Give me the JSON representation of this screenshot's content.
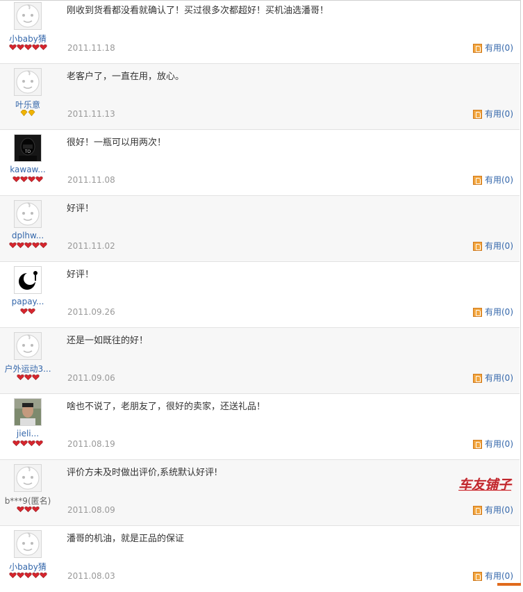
{
  "reviews": [
    {
      "user": "小baby猜",
      "rank_icon": "red-heart",
      "rank_count": 5,
      "avatar": "default-face",
      "content": "刚收到货看都没看就确认了！买过很多次都超好！买机油选潘哥！",
      "date": "2011.11.18",
      "useful": "有用(0)"
    },
    {
      "user": "叶乐意",
      "rank_icon": "yellow-diamond",
      "rank_count": 2,
      "avatar": "default-face",
      "content": "老客户了，一直在用，放心。",
      "date": "2011.11.13",
      "useful": "有用(0)"
    },
    {
      "user": "kawaw...",
      "rank_icon": "red-heart",
      "rank_count": 4,
      "avatar": "dark-figure",
      "content": "很好！一瓶可以用两次！",
      "date": "2011.11.08",
      "useful": "有用(0)"
    },
    {
      "user": "dplhw...",
      "rank_icon": "red-heart",
      "rank_count": 5,
      "avatar": "default-face",
      "content": "好评！",
      "date": "2011.11.02",
      "useful": "有用(0)"
    },
    {
      "user": "papay...",
      "rank_icon": "red-heart",
      "rank_count": 2,
      "avatar": "black-moon-logo",
      "content": "好评！",
      "date": "2011.09.26",
      "useful": "有用(0)"
    },
    {
      "user": "户外运动3...",
      "rank_icon": "red-heart",
      "rank_count": 3,
      "avatar": "default-face",
      "content": "还是一如既往的好！",
      "date": "2011.09.06",
      "useful": "有用(0)"
    },
    {
      "user": "jieli...",
      "rank_icon": "red-heart",
      "rank_count": 4,
      "avatar": "person-photo",
      "content": "啥也不说了，老朋友了，很好的卖家，还送礼品！",
      "date": "2011.08.19",
      "useful": "有用(0)"
    },
    {
      "user": "b***9(匿名)",
      "rank_icon": "red-heart",
      "rank_count": 3,
      "avatar": "default-face",
      "content": "评价方未及时做出评价,系统默认好评!",
      "date": "2011.08.09",
      "useful": "有用(0)"
    },
    {
      "user": "小baby猜",
      "rank_icon": "red-heart",
      "rank_count": 5,
      "avatar": "default-face",
      "content": "潘哥的机油，就是正品的保证",
      "date": "2011.08.03",
      "useful": "有用(0)"
    }
  ],
  "watermark": "车友铺子",
  "colors": {
    "link": "#3366aa",
    "date": "#999999",
    "watermark": "#c0272d",
    "heart": "#d8262e",
    "diamond": "#f0b400"
  }
}
